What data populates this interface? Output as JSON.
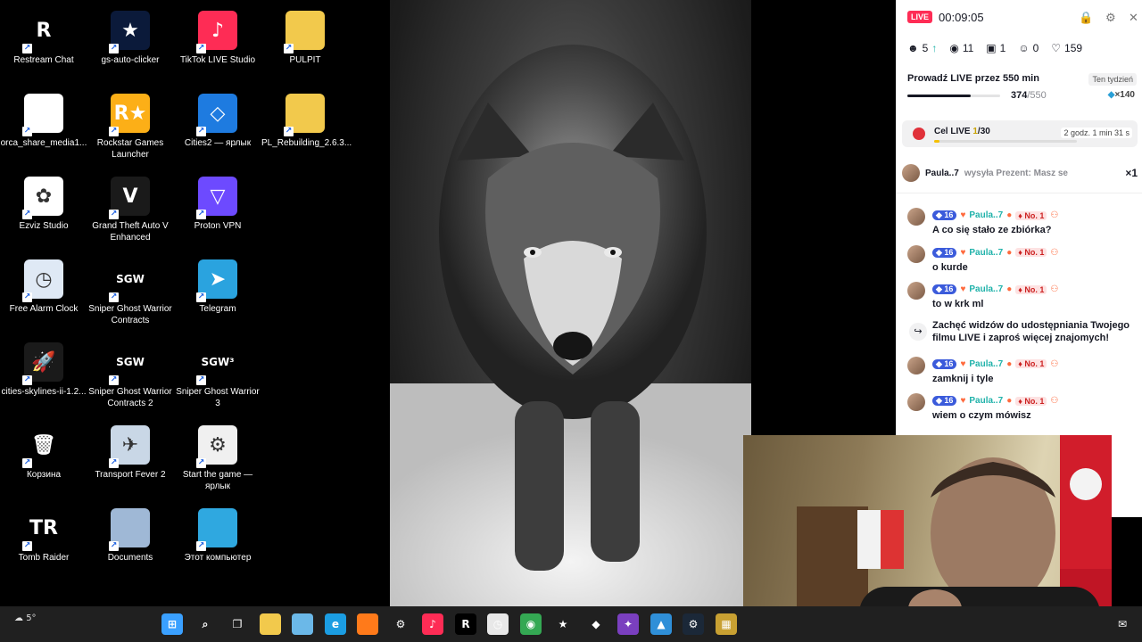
{
  "desktop": {
    "icons": [
      {
        "label": "Restream Chat",
        "glyph": "R",
        "color": "#000000",
        "icon": "restream-icon"
      },
      {
        "label": "gs-auto-clicker",
        "glyph": "★",
        "color": "#0b1a3a",
        "icon": "star-clicker-icon"
      },
      {
        "label": "TikTok LIVE Studio",
        "glyph": "♪",
        "color": "#fe2c55",
        "icon": "tiktok-live-icon"
      },
      {
        "label": "PULPIT",
        "glyph": "",
        "color": "#f2c94c",
        "icon": "folder-icon"
      },
      {
        "label": "orca_share_media1...",
        "glyph": "",
        "color": "#ffffff",
        "icon": "file-icon"
      },
      {
        "label": "Rockstar Games Launcher",
        "glyph": "R★",
        "color": "#fcaf17",
        "icon": "rockstar-icon"
      },
      {
        "label": "Cities2 — ярлык",
        "glyph": "◇",
        "color": "#1e7be0",
        "icon": "cities2-icon"
      },
      {
        "label": "PL_Rebuilding_2.6.3...",
        "glyph": "",
        "color": "#f2c94c",
        "icon": "zip-folder-icon"
      },
      {
        "label": "Ezviz Studio",
        "glyph": "✿",
        "color": "#ffffff",
        "icon": "ezviz-icon"
      },
      {
        "label": "Grand Theft Auto V Enhanced",
        "glyph": "V",
        "color": "#1a1a1a",
        "icon": "gta-icon"
      },
      {
        "label": "Proton VPN",
        "glyph": "▽",
        "color": "#6d4aff",
        "icon": "proton-vpn-icon"
      },
      {
        "label": "Free Alarm Clock",
        "glyph": "◷",
        "color": "#dfe9f5",
        "icon": "alarm-clock-icon"
      },
      {
        "label": "Sniper Ghost Warrior Contracts",
        "glyph": "SGW",
        "color": "#000000",
        "icon": "sgw-contracts-icon"
      },
      {
        "label": "Telegram",
        "glyph": "➤",
        "color": "#2aa3df",
        "icon": "telegram-icon"
      },
      {
        "label": "cities-skylines-ii-1.2...",
        "glyph": "🚀",
        "color": "#1a1a1a",
        "icon": "rocket-icon"
      },
      {
        "label": "Sniper Ghost Warrior Contracts 2",
        "glyph": "SGW",
        "color": "#000000",
        "icon": "sgw-contracts2-icon"
      },
      {
        "label": "Sniper Ghost Warrior 3",
        "glyph": "SGW³",
        "color": "#000000",
        "icon": "sgw3-icon"
      },
      {
        "label": "Корзина",
        "glyph": "🗑",
        "color": "#000000",
        "icon": "recycle-bin-icon"
      },
      {
        "label": "Transport Fever 2",
        "glyph": "✈",
        "color": "#c9d7e6",
        "icon": "transport-fever-icon"
      },
      {
        "label": "Start the game — ярлык",
        "glyph": "⚙",
        "color": "#f0f0f0",
        "icon": "settings-file-icon"
      },
      {
        "label": "Tomb Raider",
        "glyph": "TR",
        "color": "#000000",
        "icon": "tomb-raider-icon"
      },
      {
        "label": "Documents",
        "glyph": "",
        "color": "#9fb8d6",
        "icon": "documents-folder-icon"
      },
      {
        "label": "Этот компьютер",
        "glyph": "",
        "color": "#2fa8e0",
        "icon": "this-pc-icon"
      }
    ]
  },
  "live": {
    "badge": "LIVE",
    "timer": "00:09:05",
    "stats": {
      "viewers": "5",
      "views": "11",
      "gifts": "1",
      "followers": "0",
      "likes": "159"
    },
    "goal_title": "Prowadź LIVE przez 550 min",
    "week_tag": "Ten tydzień",
    "progress_current": "374",
    "progress_total": "/550",
    "progress_fraction": 0.68,
    "gem_reward": "×140",
    "cel_label": "Cel LIVE ",
    "cel_current": "1",
    "cel_total": "/30",
    "cel_fraction": 0.033,
    "cel_time": "2 godz. 1 min 31 s",
    "gift_user": "Paula..7",
    "gift_message": "wysyła Prezent: Masz se",
    "gift_count": "×1",
    "chat": [
      {
        "type": "user",
        "level": "16",
        "user": "Paula..7",
        "rank": "No. 1",
        "text": "A co się stało ze zbiórka?"
      },
      {
        "type": "user",
        "level": "16",
        "user": "Paula..7",
        "rank": "No. 1",
        "text": "o kurde"
      },
      {
        "type": "user",
        "level": "16",
        "user": "Paula..7",
        "rank": "No. 1",
        "text": "to w krk ml"
      },
      {
        "type": "system",
        "text": "Zachęć widzów do udostępniania Twojego filmu LIVE i zaproś więcej znajomych!"
      },
      {
        "type": "user",
        "level": "16",
        "user": "Paula..7",
        "rank": "No. 1",
        "text": "zamknij i tyle"
      },
      {
        "type": "user",
        "level": "16",
        "user": "Paula..7",
        "rank": "No. 1",
        "text": "wiem o czym mówisz"
      }
    ]
  },
  "taskbar": {
    "weather": "5°",
    "apps": [
      {
        "icon": "windows-start-icon",
        "glyph": "⊞",
        "color": "#3aa0ff"
      },
      {
        "icon": "search-icon",
        "glyph": "⌕",
        "color": "#202020"
      },
      {
        "icon": "task-view-icon",
        "glyph": "❐",
        "color": "#202020"
      },
      {
        "icon": "file-explorer-icon",
        "glyph": "",
        "color": "#f2c94c"
      },
      {
        "icon": "paint-icon",
        "glyph": "",
        "color": "#6bb8e8"
      },
      {
        "icon": "edge-icon",
        "glyph": "e",
        "color": "#1b9de2"
      },
      {
        "icon": "firefox-icon",
        "glyph": "",
        "color": "#ff7a1a"
      },
      {
        "icon": "obs-like-icon",
        "glyph": "⚙",
        "color": "#202020"
      },
      {
        "icon": "tiktok-studio-icon",
        "glyph": "♪",
        "color": "#fe2c55"
      },
      {
        "icon": "restream-icon",
        "glyph": "R",
        "color": "#000000"
      },
      {
        "icon": "clock-app-icon",
        "glyph": "◷",
        "color": "#e8e8e8"
      },
      {
        "icon": "chrome-icon",
        "glyph": "◉",
        "color": "#34a853"
      },
      {
        "icon": "star-clicker-icon",
        "glyph": "★",
        "color": "#202020"
      },
      {
        "icon": "cube-app-icon",
        "glyph": "◆",
        "color": "#202020"
      },
      {
        "icon": "game-app-icon",
        "glyph": "✦",
        "color": "#7a3fbf"
      },
      {
        "icon": "photos-icon",
        "glyph": "▲",
        "color": "#2f8fd8"
      },
      {
        "icon": "steam-icon",
        "glyph": "⚙",
        "color": "#1b2838"
      },
      {
        "icon": "farm-game-icon",
        "glyph": "▦",
        "color": "#c8a032"
      }
    ]
  }
}
